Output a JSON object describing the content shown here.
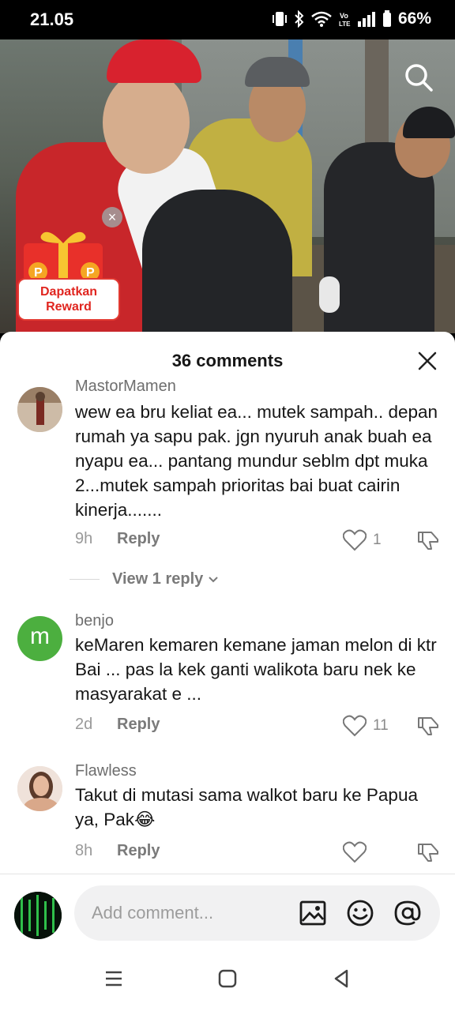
{
  "status": {
    "time": "21.05",
    "battery": "66%",
    "icons": [
      "vibrate-icon",
      "bluetooth-icon",
      "wifi-icon",
      "volte-icon",
      "signal-icon",
      "battery-icon"
    ]
  },
  "video": {
    "search_icon": "search-icon"
  },
  "reward": {
    "label_line1": "Dapatkan",
    "label_line2": "Reward",
    "close": "×"
  },
  "comments_panel": {
    "title": "36 comments",
    "close_icon": "close-icon",
    "comments": [
      {
        "user": "MastorMamen",
        "text": "wew ea bru keliat ea... mutek sampah.. depan rumah ya sapu pak. jgn nyuruh anak buah ea nyapu ea... pantang mundur seblm dpt muka 2...mutek sampah prioritas bai buat cairin kinerja.......",
        "time": "9h",
        "reply": "Reply",
        "likes": "1"
      },
      {
        "user": "benjo",
        "avatar_letter": "m",
        "text": "keMaren kemaren kemane jaman melon di ktr Bai ... pas la kek ganti walikota baru nek ke masyarakat e ...",
        "time": "2d",
        "reply": "Reply",
        "likes": "11"
      },
      {
        "user": "Flawless",
        "text": "Takut di mutasi sama walkot baru ke Papua ya, Pak😂",
        "time": "8h",
        "reply": "Reply",
        "likes": ""
      }
    ],
    "view_replies": "View 1 reply"
  },
  "input": {
    "placeholder": "Add comment..."
  },
  "colors": {
    "accent_red": "#e0251f",
    "avatar_green": "#4caf3f",
    "text_primary": "#161616",
    "text_secondary": "#8a8a8a"
  }
}
